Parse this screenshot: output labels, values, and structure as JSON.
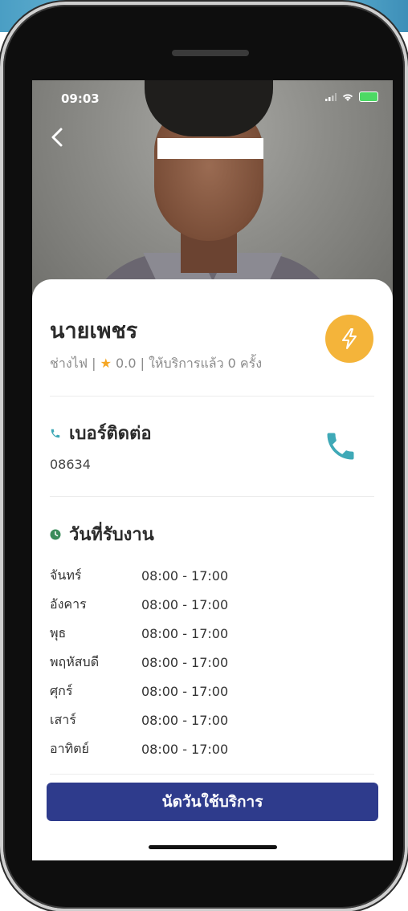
{
  "status_bar": {
    "time": "09:03"
  },
  "profile": {
    "name": "นายเพชร",
    "occupation": "ช่างไฟ",
    "rating": "0.0",
    "served_text": "ให้บริการแล้ว 0 ครั้ง"
  },
  "contact": {
    "title": "เบอร์ติดต่อ",
    "phone": "08634"
  },
  "schedule": {
    "title": "วันที่รับงาน",
    "days": [
      {
        "day": "จันทร์",
        "time": "08:00 - 17:00"
      },
      {
        "day": "อังคาร",
        "time": "08:00 - 17:00"
      },
      {
        "day": "พุธ",
        "time": "08:00 - 17:00"
      },
      {
        "day": "พฤหัสบดี",
        "time": "08:00 - 17:00"
      },
      {
        "day": "ศุกร์",
        "time": "08:00 - 17:00"
      },
      {
        "day": "เสาร์",
        "time": "08:00 - 17:00"
      },
      {
        "day": "อาทิตย์",
        "time": "08:00 - 17:00"
      }
    ]
  },
  "action": {
    "book_label": "นัดวันใช้บริการ"
  },
  "colors": {
    "primary": "#2e3b8c",
    "accent_teal": "#3fa9b7",
    "badge_yellow": "#f4b43a",
    "clock_green": "#3b8c5a"
  },
  "icons": {
    "back": "chevron-left-icon",
    "badge": "lightning-icon",
    "call": "phone-icon",
    "section_contact": "phone-icon",
    "section_schedule": "clock-icon"
  }
}
